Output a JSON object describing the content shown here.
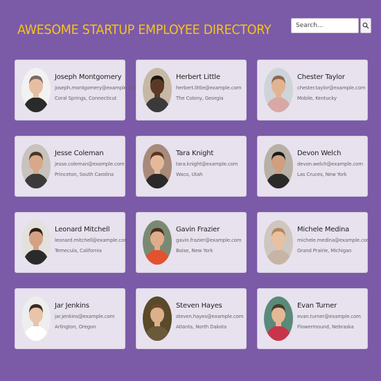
{
  "header": {
    "title": "AWESOME STARTUP EMPLOYEE DIRECTORY",
    "search_placeholder": "Search...",
    "search_icon": "magnifier-icon"
  },
  "employees": [
    {
      "name": "Joseph Montgomery",
      "email": "joseph.montgomery@example.com",
      "location": "Coral Springs, Connecticut",
      "skin": "#e6bfa2",
      "hair": "#7a6a5e",
      "shirt": "#2a2a2a",
      "bg": "#f2f2f2"
    },
    {
      "name": "Herbert Little",
      "email": "herbert.little@example.com",
      "location": "The Colony, Georgia",
      "skin": "#5a3a26",
      "hair": "#1e1410",
      "shirt": "#3a3a3a",
      "bg": "#c7b8a6"
    },
    {
      "name": "Chester Taylor",
      "email": "chester.taylor@example.com",
      "location": "Mobile, Kentucky",
      "skin": "#e2b393",
      "hair": "#8a6a4e",
      "shirt": "#d8a8a4",
      "bg": "#cfd4d8"
    },
    {
      "name": "Jesse Coleman",
      "email": "jesse.coleman@example.com",
      "location": "Princeton, South Carolina",
      "skin": "#d8a888",
      "hair": "#4a3424",
      "shirt": "#3a3a3a",
      "bg": "#c9c2bd"
    },
    {
      "name": "Tara Knight",
      "email": "tara.knight@example.com",
      "location": "Waco, Utah",
      "skin": "#e6b89a",
      "hair": "#5a3424",
      "shirt": "#2a2a2a",
      "bg": "#a88a7a"
    },
    {
      "name": "Devon Welch",
      "email": "devon.welch@example.com",
      "location": "Las Cruces, New York",
      "skin": "#cf9f80",
      "hair": "#1a1a1a",
      "shirt": "#2a2a2a",
      "bg": "#b8b0a6"
    },
    {
      "name": "Leonard Mitchell",
      "email": "leonard.mitchell@example.com",
      "location": "Temecula, California",
      "skin": "#d4a282",
      "hair": "#2e2018",
      "shirt": "#2a2a2a",
      "bg": "#e4e0dc"
    },
    {
      "name": "Gavin Frazier",
      "email": "gavin.frazier@example.com",
      "location": "Boise, New York",
      "skin": "#e0ad8c",
      "hair": "#4a2e1e",
      "shirt": "#e2522e",
      "bg": "#7a8a72"
    },
    {
      "name": "Michele Medina",
      "email": "michele.medina@example.com",
      "location": "Grand Prairie, Michigan",
      "skin": "#e8c0a4",
      "hair": "#b08858",
      "shirt": "#c8b4a4",
      "bg": "#cfc6bf"
    },
    {
      "name": "Jar Jenkins",
      "email": "jar.jenkins@example.com",
      "location": "Arlington, Oregon",
      "skin": "#e8c4aa",
      "hair": "#3a2a1e",
      "shirt": "#ffffff",
      "bg": "#eeeeee"
    },
    {
      "name": "Steven Hayes",
      "email": "steven.hayes@example.com",
      "location": "Atlanta, North Dakota",
      "skin": "#dcb08a",
      "hair": "#6a4a2a",
      "shirt": "#6a5a3a",
      "bg": "#5a4a2a"
    },
    {
      "name": "Evan Turner",
      "email": "evan.turner@example.com",
      "location": "Flowermound, Nebraska",
      "skin": "#e2b896",
      "hair": "#4a3a2a",
      "shirt": "#c8344a",
      "bg": "#5a8a7a"
    }
  ]
}
